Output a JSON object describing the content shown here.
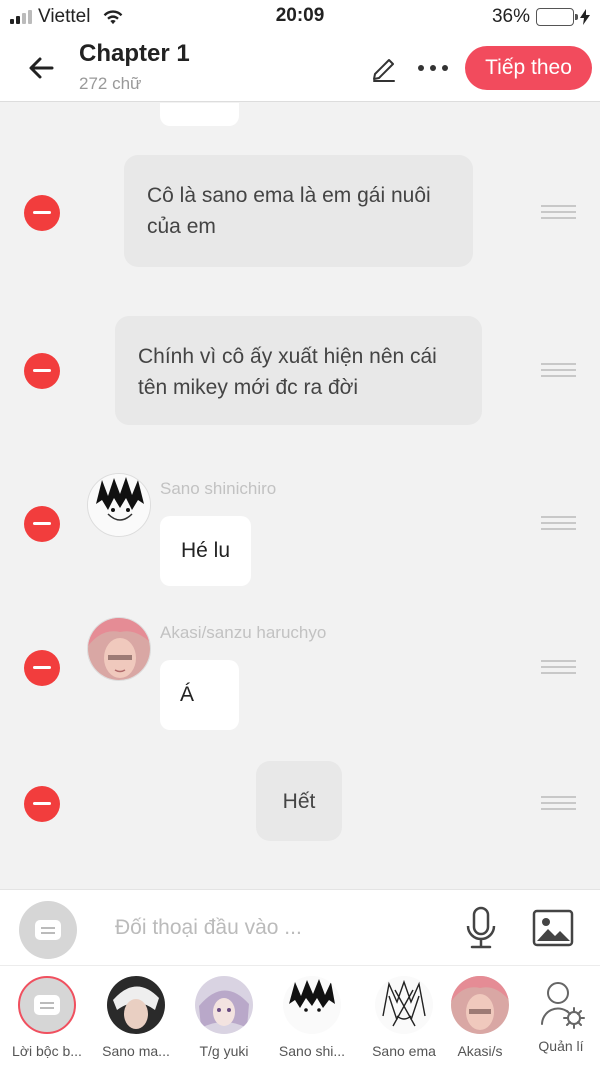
{
  "status_bar": {
    "carrier": "Viettel",
    "time": "20:09",
    "battery": "36%",
    "battery_level": 0.36
  },
  "header": {
    "title": "Chapter 1",
    "subtitle": "272 chữ",
    "next_label": "Tiếp theo"
  },
  "messages": [
    {
      "type": "character",
      "text": "",
      "partial": true
    },
    {
      "type": "narration",
      "text": "Cô là sano ema là em gái nuôi của em"
    },
    {
      "type": "narration",
      "text": "Chính vì cô ấy xuất hiện nên cái tên mikey mới đc ra đời"
    },
    {
      "type": "character",
      "name": "Sano shinichiro",
      "text": "Hé lu"
    },
    {
      "type": "character",
      "name": "Akasi/sanzu haruchyo",
      "text": "Á"
    },
    {
      "type": "narration",
      "text": "Hết"
    }
  ],
  "input": {
    "placeholder": "Đối thoại đầu vào ..."
  },
  "characters": [
    {
      "label": "Lời bộc b...",
      "icon": "narration-card-icon",
      "selected": true
    },
    {
      "label": "Sano ma..."
    },
    {
      "label": "T/g yuki"
    },
    {
      "label": "Sano shi..."
    },
    {
      "label": "Sano ema"
    },
    {
      "label": "Akasi/s"
    },
    {
      "label": "Quản lí",
      "icon": "manage-user-icon"
    }
  ],
  "colors": {
    "accent": "#f24b5d",
    "delete": "#f23d3d",
    "battery": "#f5c518"
  }
}
